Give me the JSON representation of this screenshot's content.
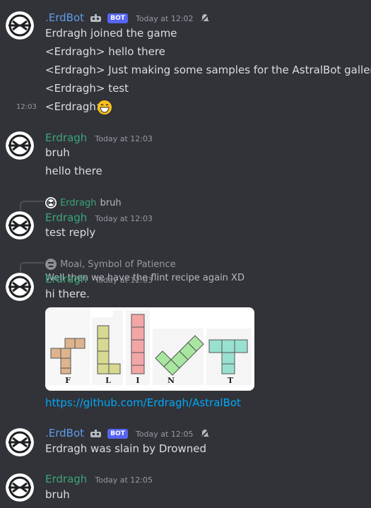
{
  "colors": {
    "bg": "#313338",
    "bot_name": "#5f9be8",
    "user_name": "#3aa57a",
    "link": "#00a8fc",
    "badge": "#5865f2"
  },
  "messages": [
    {
      "author": ".ErdBot",
      "badge": "BOT",
      "timestamp": "Today at 12:02",
      "lines": [
        "Erdragh joined the game",
        "<Erdragh> hello there",
        "<Erdragh> Just making some samples for the AstralBot gallery",
        "<Erdragh> test",
        "<Erdragh>"
      ],
      "side_timestamp": "12:03",
      "emoji": "grinning-emoji"
    },
    {
      "author": "Erdragh",
      "timestamp": "Today at 12:03",
      "lines": [
        "bruh",
        "hello there"
      ]
    },
    {
      "reply": {
        "author": "Erdragh",
        "text": "bruh"
      },
      "author": "Erdragh",
      "timestamp": "Today at 12:03",
      "lines": [
        "test reply"
      ]
    },
    {
      "reply": {
        "author": "Moai, Symbol of Patience",
        "text": "Well then we have the flint recipe again XD"
      },
      "author": "Erdragh",
      "timestamp": "Today at 12:03",
      "lines": [
        "hi there."
      ],
      "attachment": {
        "letters": [
          "F",
          "L",
          "I",
          "N",
          "T"
        ]
      },
      "link": "https://github.com/Erdragh/AstralBot"
    },
    {
      "author": ".ErdBot",
      "badge": "BOT",
      "timestamp": "Today at 12:05",
      "lines": [
        "Erdragh was slain by Drowned"
      ]
    },
    {
      "author": "Erdragh",
      "timestamp": "Today at 12:05",
      "lines": [
        "bruh"
      ]
    }
  ]
}
